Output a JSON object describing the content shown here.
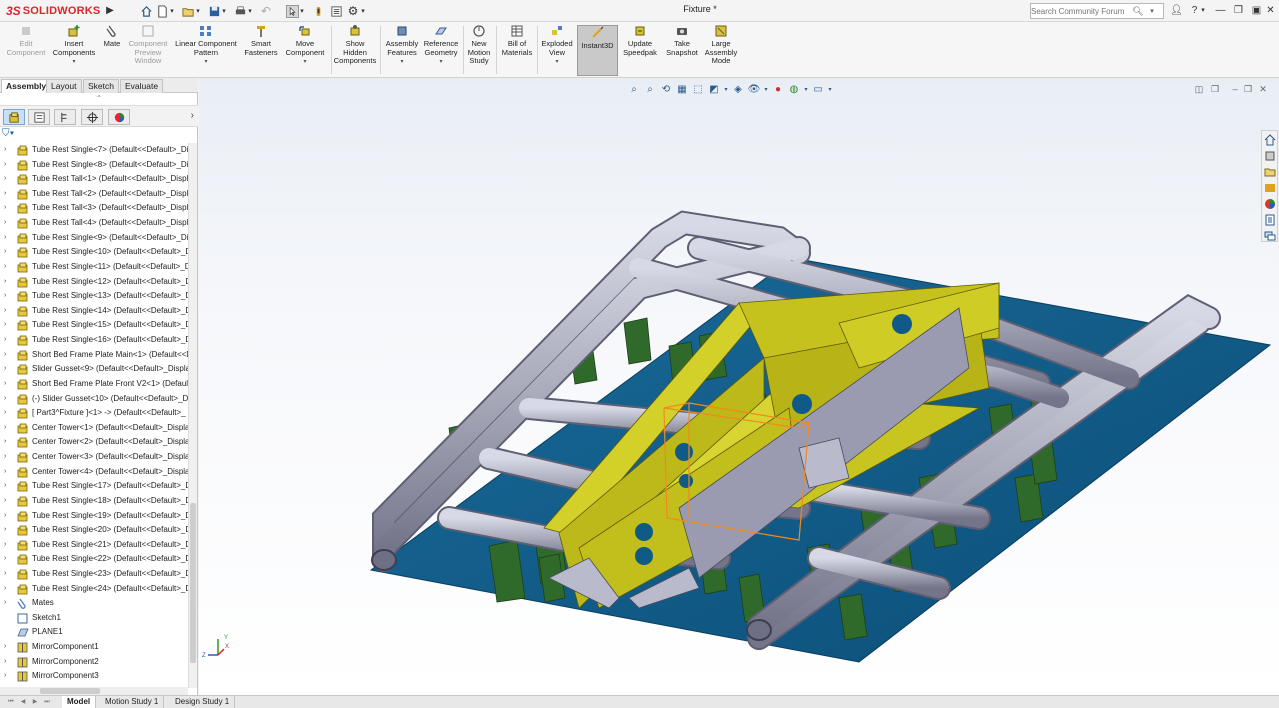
{
  "titlebar": {
    "app_name": "SOLIDWORKS",
    "doc_title": "Fixture *",
    "search_placeholder": "Search Community Forum",
    "help": "?"
  },
  "commands": [
    {
      "label": "Edit Component",
      "enabled": false
    },
    {
      "label": "Insert Components",
      "enabled": true
    },
    {
      "label": "Mate",
      "enabled": true
    },
    {
      "label": "Component Preview Window",
      "enabled": false
    },
    {
      "label": "Linear Component Pattern",
      "enabled": true
    },
    {
      "label": "Smart Fasteners",
      "enabled": true
    },
    {
      "label": "Move Component",
      "enabled": true
    },
    {
      "label": "Show Hidden Components",
      "enabled": true
    },
    {
      "label": "Assembly Features",
      "enabled": true
    },
    {
      "label": "Reference Geometry",
      "enabled": true
    },
    {
      "label": "New Motion Study",
      "enabled": true
    },
    {
      "label": "Bill of Materials",
      "enabled": true
    },
    {
      "label": "Exploded View",
      "enabled": true
    },
    {
      "label": "Instant3D",
      "enabled": true,
      "active": true
    },
    {
      "label": "Update Speedpak",
      "enabled": true
    },
    {
      "label": "Take Snapshot",
      "enabled": true
    },
    {
      "label": "Large Assembly Mode",
      "enabled": true
    }
  ],
  "command_tabs": [
    "Assembly",
    "Layout",
    "Sketch",
    "Evaluate"
  ],
  "active_command_tab": "Assembly",
  "tree": [
    {
      "label": "Tube Rest Single<7> (Default<<Default>_Di",
      "icon": "part"
    },
    {
      "label": "Tube Rest Single<8> (Default<<Default>_Di",
      "icon": "part"
    },
    {
      "label": "Tube Rest Tall<1> (Default<<Default>_Displ",
      "icon": "part"
    },
    {
      "label": "Tube Rest Tall<2> (Default<<Default>_Displ",
      "icon": "part"
    },
    {
      "label": "Tube Rest Tall<3> (Default<<Default>_Displ",
      "icon": "part"
    },
    {
      "label": "Tube Rest Tall<4> (Default<<Default>_Displ",
      "icon": "part"
    },
    {
      "label": "Tube Rest Single<9> (Default<<Default>_Di",
      "icon": "part"
    },
    {
      "label": "Tube Rest Single<10> (Default<<Default>_D",
      "icon": "part"
    },
    {
      "label": "Tube Rest Single<11> (Default<<Default>_D",
      "icon": "part"
    },
    {
      "label": "Tube Rest Single<12> (Default<<Default>_D",
      "icon": "part"
    },
    {
      "label": "Tube Rest Single<13> (Default<<Default>_D",
      "icon": "part"
    },
    {
      "label": "Tube Rest Single<14> (Default<<Default>_D",
      "icon": "part"
    },
    {
      "label": "Tube Rest Single<15> (Default<<Default>_D",
      "icon": "part"
    },
    {
      "label": "Tube Rest Single<16> (Default<<Default>_D",
      "icon": "part"
    },
    {
      "label": "Short Bed Frame Plate Main<1> (Default<<D",
      "icon": "part"
    },
    {
      "label": "Slider Gusset<9> (Default<<Default>_Displa",
      "icon": "part"
    },
    {
      "label": "Short Bed Frame Plate Front V2<1> (Default-",
      "icon": "part"
    },
    {
      "label": "(-) Slider Gusset<10> (Default<<Default>_Di",
      "icon": "part"
    },
    {
      "label": "[ Part3^Fixture ]<1> -> (Default<<Default>_",
      "icon": "part"
    },
    {
      "label": "Center Tower<1> (Default<<Default>_Displa",
      "icon": "part"
    },
    {
      "label": "Center Tower<2> (Default<<Default>_Displa",
      "icon": "part"
    },
    {
      "label": "Center Tower<3> (Default<<Default>_Displa",
      "icon": "part"
    },
    {
      "label": "Center Tower<4> (Default<<Default>_Displa",
      "icon": "part"
    },
    {
      "label": "Tube Rest Single<17> (Default<<Default>_D",
      "icon": "part"
    },
    {
      "label": "Tube Rest Single<18> (Default<<Default>_D",
      "icon": "part"
    },
    {
      "label": "Tube Rest Single<19> (Default<<Default>_D",
      "icon": "part"
    },
    {
      "label": "Tube Rest Single<20> (Default<<Default>_D",
      "icon": "part"
    },
    {
      "label": "Tube Rest Single<21> (Default<<Default>_D",
      "icon": "part"
    },
    {
      "label": "Tube Rest Single<22> (Default<<Default>_D",
      "icon": "part"
    },
    {
      "label": "Tube Rest Single<23> (Default<<Default>_D",
      "icon": "part"
    },
    {
      "label": "Tube Rest Single<24> (Default<<Default>_D",
      "icon": "part"
    },
    {
      "label": "Mates",
      "icon": "mates"
    },
    {
      "label": "Sketch1",
      "icon": "sketch"
    },
    {
      "label": "PLANE1",
      "icon": "plane"
    },
    {
      "label": "MirrorComponent1",
      "icon": "mirror"
    },
    {
      "label": "MirrorComponent2",
      "icon": "mirror"
    },
    {
      "label": "MirrorComponent3",
      "icon": "mirror"
    }
  ],
  "bottom_tabs": [
    "Model",
    "Motion Study 1",
    "Design Study 1"
  ],
  "active_bottom_tab": "Model",
  "triad": {
    "x": "X",
    "y": "Y",
    "z": "Z"
  },
  "colors": {
    "plate": "#0f5a86",
    "tube": "#a8a9b9",
    "yellow": "#c5c21e",
    "green": "#2f6a2a",
    "selection": "#f08a1e"
  }
}
